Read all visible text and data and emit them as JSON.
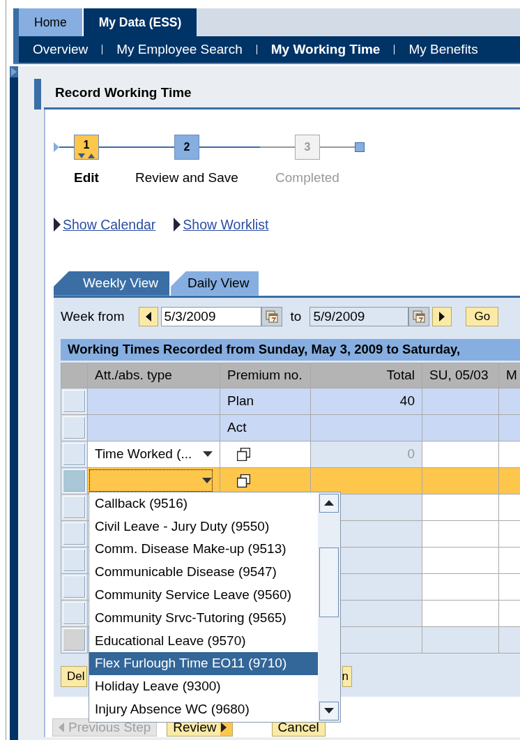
{
  "top_tabs": [
    {
      "label": "Home",
      "selected": false
    },
    {
      "label": "My Data (ESS)",
      "selected": true
    }
  ],
  "sub_nav": [
    {
      "label": "Overview",
      "selected": false
    },
    {
      "label": "My Employee Search",
      "selected": false
    },
    {
      "label": "My Working Time",
      "selected": true
    },
    {
      "label": "My Benefits",
      "selected": false
    }
  ],
  "panel": {
    "title": "Record Working Time"
  },
  "roadmap": [
    {
      "number": "1",
      "label": "Edit",
      "current": true,
      "disabled": false
    },
    {
      "number": "2",
      "label": "Review and Save",
      "current": false,
      "disabled": false
    },
    {
      "number": "3",
      "label": "Completed",
      "current": false,
      "disabled": true
    }
  ],
  "links": [
    "Show Calendar",
    "Show Worklist"
  ],
  "view_tabs": [
    {
      "label": "Weekly View",
      "selected": true
    },
    {
      "label": "Daily View",
      "selected": false
    }
  ],
  "week": {
    "label": "Week from",
    "from": "5/3/2009",
    "to_label": "to",
    "to": "5/9/2009",
    "go": "Go"
  },
  "table": {
    "title": "Working Times Recorded from Sunday, May 3, 2009 to Saturday,",
    "columns": [
      "Att./abs. type",
      "Premium no.",
      "Total",
      "SU, 05/03",
      "M"
    ],
    "rows": [
      {
        "kind": "summary",
        "premium": "Plan",
        "total": "40",
        "selected": false
      },
      {
        "kind": "summary",
        "premium": "Act",
        "selected": false
      },
      {
        "kind": "entry",
        "type": "Time Worked (...",
        "total": "0",
        "selected": false
      },
      {
        "kind": "entry",
        "selected": true
      },
      {
        "kind": "blank",
        "selected": false
      },
      {
        "kind": "blank",
        "selected": false
      },
      {
        "kind": "blank",
        "selected": false
      },
      {
        "kind": "blank",
        "selected": false
      },
      {
        "kind": "blank",
        "selected": false
      },
      {
        "kind": "footer",
        "selected": false
      }
    ]
  },
  "dropdown": {
    "items": [
      {
        "label": "Callback (9516)",
        "selected": false
      },
      {
        "label": "Civil Leave - Jury Duty (9550)",
        "selected": false
      },
      {
        "label": "Comm. Disease Make-up (9513)",
        "selected": false
      },
      {
        "label": "Communicable Disease (9547)",
        "selected": false
      },
      {
        "label": "Community Service Leave (9560)",
        "selected": false
      },
      {
        "label": "Community Srvc-Tutoring (9565)",
        "selected": false
      },
      {
        "label": "Educational Leave (9570)",
        "selected": false
      },
      {
        "label": "Flex Furlough Time EO11 (9710)",
        "selected": true
      },
      {
        "label": "Holiday Leave (9300)",
        "selected": false
      },
      {
        "label": "Injury Absence WC (9680)",
        "selected": false
      }
    ]
  },
  "table_buttons": [
    "Del",
    "n"
  ],
  "footer_buttons": [
    {
      "label": "Previous Step",
      "kind": "back",
      "disabled": true
    },
    {
      "label": "Review",
      "kind": "forward",
      "disabled": false
    },
    {
      "label": "Cancel",
      "kind": "plain",
      "disabled": false
    }
  ]
}
